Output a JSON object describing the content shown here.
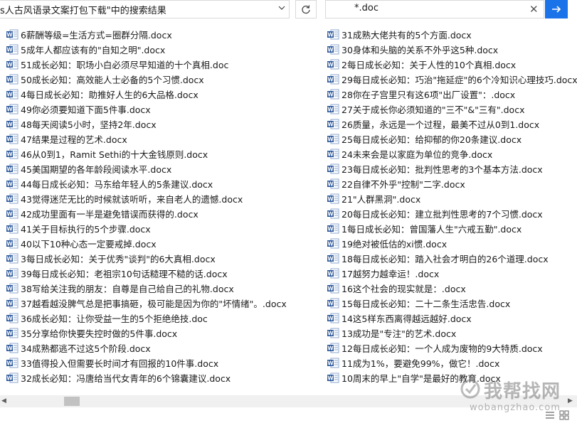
{
  "address_bar": {
    "text": "s人古风语录文案打包下载\"中的搜索结果"
  },
  "search": {
    "value": "*.doc"
  },
  "icons": {
    "chevron": "chevron-down-icon",
    "refresh": "refresh-icon",
    "clear": "close-icon",
    "go": "arrow-right-icon",
    "file": "word-document-icon"
  },
  "colors": {
    "accent": "#1a73e8",
    "word_icon": "#2b579a"
  },
  "results": {
    "left": [
      "6薪酬等级=生活方式=圈群分隔.docx",
      "5成年人都应该有的\"自知之明\".docx",
      "51成长必知：职场小白必须尽早知道的十个真相.doc",
      "50成长必知：高效能人士必备的5个习惯.docx",
      "4每日成长必知：助推好人生的6大品格.docx",
      "49你必须要知道下面5件事.docx",
      "48每天阅读5小时，坚持2年.docx",
      "47结果是过程的艺术.docx",
      "46从0到1，Ramit Sethi的十大金钱原则.docx",
      "45美国期望的各年龄段阅读水平.docx",
      "44每日成长必知：马东给年轻人的5条建议.docx",
      "43觉得迷茫无比的时候就该听听，来自老人的遗憾.docx",
      "42成功里面有一半是避免错误而获得的.docx",
      "41关于目标执行的5个步骤.docx",
      "40以下10种心态一定要戒掉.docx",
      "3每日成长必知：关于优秀\"谈判\"的6大真相.docx",
      "39每日成长必知：老祖宗10句话糙理不糙的话.docx",
      "38写给关注我的朋友：自尊是自己给自己的礼物.docx",
      "37越看越没脾气总是把事搞砸，极可能是因为你的\"坏情绪\"。.docx",
      "36成长必知：让你受益一生的5个拒绝绝技.doc",
      "35分享给你快要失控时做的5件事.docx",
      "34成熟都逃不过这5个阶段.docx",
      "33值得投入但需要长时间才有回报的10件事.docx",
      "32成长必知：冯唐给当代女青年的6个锦囊建议.docx"
    ],
    "right": [
      "31成熟大佬共有的5个方面.docx",
      "30身体和头脑的关系不外乎这5种.docx",
      "2每日成长必知：关于人性的10个真相.docx",
      "29每日成长必知：巧治\"拖延症\"的6个冷知识心理技巧.docx",
      "28你在子宫里只有这6项\"出厂设置\"：.docx",
      "27关于成长你必须知道的\"三不\"&\"三有\".docx",
      "26质量，永远是一个过程，最美不过从0到1.docx",
      "25每日成长必知：给抑郁的你20条建议.docx",
      "24未来会是以家庭为单位的竞争.docx",
      "23每日成长必知：批判性思考的3个基本方法.docx",
      "22自律不外乎\"控制\"二字.docx",
      "21\"人群黑洞\".docx",
      "20每日成长必知：建立批判性思考的7个习惯.docx",
      "1每日成长必知：曾国藩人生\"六戒五勤\".docx",
      "19绝对被低估的xi惯.docx",
      "18每日成长必知：踏入社会才明白的26个道理.docx",
      "17越努力越幸运！.docx",
      "16这个社会的现实就是：.docx",
      "15每日成长必知：二十二条生活忠告.docx",
      "14这5样东西离得越远越好.docx",
      "13成功是\"专注\"的艺术.docx",
      "12每日成长必知：一个人成为废物的9大特质.docx",
      "11成为1%，要避免99%，做它！.docx",
      "10周末的早上\"自学\"是最好的教育.docx"
    ]
  },
  "watermark": {
    "brand": "我帮找网",
    "url": "wobangzhao.com"
  }
}
